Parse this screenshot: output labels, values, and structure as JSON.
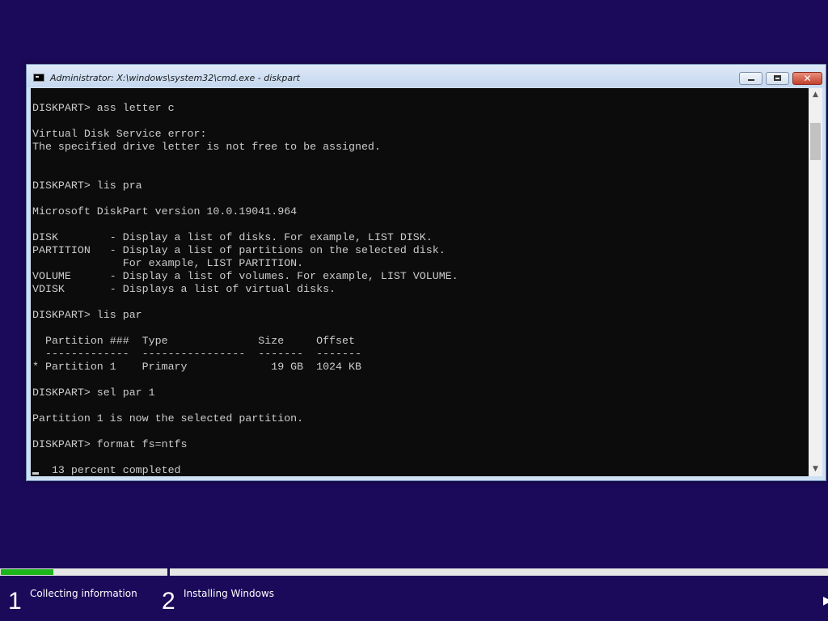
{
  "window": {
    "title": "Administrator: X:\\windows\\system32\\cmd.exe - diskpart",
    "minimize_icon": "minimize-icon",
    "maximize_icon": "maximize-icon",
    "close_icon": "close-icon",
    "close_glyph": "✕"
  },
  "console": {
    "lines": [
      "DISKPART> ass letter c",
      "",
      "Virtual Disk Service error:",
      "The specified drive letter is not free to be assigned.",
      "",
      "",
      "DISKPART> lis pra",
      "",
      "Microsoft DiskPart version 10.0.19041.964",
      "",
      "DISK        - Display a list of disks. For example, LIST DISK.",
      "PARTITION   - Display a list of partitions on the selected disk.",
      "              For example, LIST PARTITION.",
      "VOLUME      - Display a list of volumes. For example, LIST VOLUME.",
      "VDISK       - Displays a list of virtual disks.",
      "",
      "DISKPART> lis par",
      "",
      "  Partition ###  Type              Size     Offset",
      "  -------------  ----------------  -------  -------",
      "* Partition 1    Primary             19 GB  1024 KB",
      "",
      "DISKPART> sel par 1",
      "",
      "Partition 1 is now the selected partition.",
      "",
      "DISKPART> format fs=ntfs",
      "",
      "   13 percent completed"
    ]
  },
  "scrollbar": {
    "up_glyph": "▲",
    "down_glyph": "▼"
  },
  "setup": {
    "progress_fraction": 0.064,
    "progress_color": "#1cb51c",
    "steps": [
      {
        "number": "1",
        "label": "Collecting information"
      },
      {
        "number": "2",
        "label": "Installing Windows"
      }
    ],
    "corner_glyph": "▶"
  },
  "colors": {
    "background": "#1b0a5a",
    "console_bg": "#0c0c0c",
    "console_text": "#cccccc"
  }
}
